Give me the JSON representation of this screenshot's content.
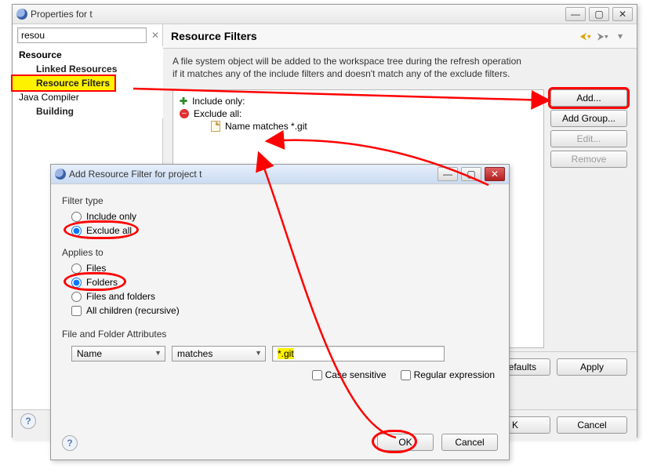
{
  "props": {
    "title": "Properties for t",
    "filter_value": "resou",
    "tree": {
      "resource": "Resource",
      "linked": "Linked Resources",
      "filters": "Resource Filters",
      "java": "Java Compiler",
      "building": "Building"
    },
    "header": "Resource Filters",
    "desc1": "A file system object will be added to the workspace tree during the refresh operation",
    "desc2": "if it matches any of the include filters and doesn't match any of the exclude filters.",
    "list": {
      "include": "Include only:",
      "exclude": "Exclude all:",
      "rule": "Name matches *.git"
    },
    "buttons": {
      "add": "Add...",
      "add_group": "Add Group...",
      "edit": "Edit...",
      "remove": "Remove"
    },
    "bottom": {
      "restore": "e Defaults",
      "apply": "Apply",
      "ok": "K",
      "cancel": "Cancel"
    }
  },
  "dlg": {
    "title": "Add Resource Filter for project t",
    "filter_type": "Filter type",
    "include_only": "Include only",
    "exclude_all": "Exclude all",
    "applies_to": "Applies to",
    "files": "Files",
    "folders": "Folders",
    "files_folders": "Files and folders",
    "all_children": "All children (recursive)",
    "attrs_title": "File and Folder Attributes",
    "attr_field": "Name",
    "attr_op": "matches",
    "attr_value": "*.git",
    "case_sensitive": "Case sensitive",
    "regex": "Regular expression",
    "ok": "OK",
    "cancel": "Cancel"
  }
}
